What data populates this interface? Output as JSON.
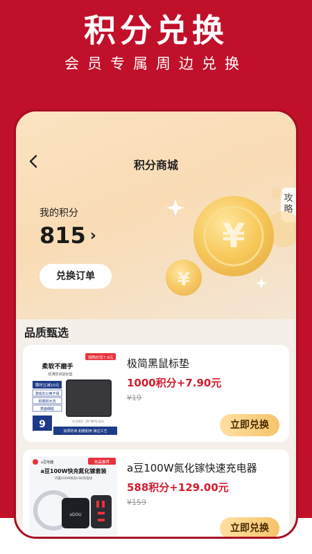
{
  "promo": {
    "title": "积分兑换",
    "subtitle": "会员专属周边兑换"
  },
  "nav": {
    "title": "积分商城",
    "guide_label": "攻略"
  },
  "points": {
    "label": "我的积分",
    "value": "815",
    "order_button": "兑换订单"
  },
  "section": {
    "title": "品质甄选"
  },
  "products": [
    {
      "name": "极简黑鼠标垫",
      "price": "1000积分+7.90元",
      "original_price": "¥19",
      "button": "立即兑换",
      "thumb": {
        "badge": "加购价仅7.9元",
        "headline": "柔软不磨手",
        "subline": "轻薄防滑鼠标垫",
        "tag1": "限时立减10元",
        "tag2": "游戏办公两不误",
        "tag3": "耐磨耐水洗",
        "tag4": "表面细腻",
        "price_tag": "9",
        "size_text": "尺寸(约)：25*30*0.3cm",
        "footer": "加厚防滑 耐磨耐用 锁边工艺"
      }
    },
    {
      "name": "a豆100W氮化镓快速充电器",
      "price": "588积分+129.00元",
      "original_price": "¥159",
      "button": "立即兑换",
      "thumb": {
        "badge": "热品推荐",
        "brand": "a豆电器",
        "headline": "a豆100W快充氮化镓套装",
        "subline": "内置100W快充USB充电线",
        "device_label": "aDOU"
      }
    }
  ],
  "colors": {
    "brand_red": "#c0102a",
    "price_red": "#d31c2e",
    "button_gold": "#f5c36a"
  }
}
